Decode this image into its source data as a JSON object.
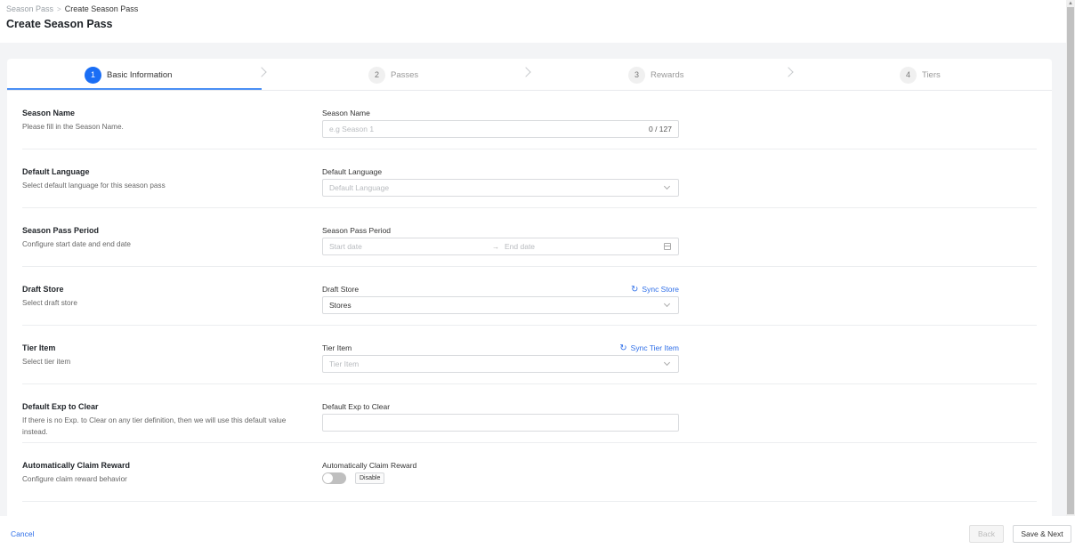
{
  "breadcrumb": {
    "parent": "Season Pass",
    "separator": ">",
    "current": "Create Season Pass"
  },
  "page_title": "Create Season Pass",
  "steps": [
    {
      "number": "1",
      "label": "Basic Information",
      "active": true
    },
    {
      "number": "2",
      "label": "Passes",
      "active": false
    },
    {
      "number": "3",
      "label": "Rewards",
      "active": false
    },
    {
      "number": "4",
      "label": "Tiers",
      "active": false
    }
  ],
  "form": {
    "season_name": {
      "title": "Season Name",
      "description": "Please fill in the Season Name.",
      "field_label": "Season Name",
      "placeholder": "e.g Season 1",
      "value": "",
      "counter": "0 / 127"
    },
    "default_language": {
      "title": "Default Language",
      "description": "Select default language for this season pass",
      "field_label": "Default Language",
      "placeholder": "Default Language"
    },
    "season_pass_period": {
      "title": "Season Pass Period",
      "description": "Configure start date and end date",
      "field_label": "Season Pass Period",
      "start_placeholder": "Start date",
      "separator": "→",
      "end_placeholder": "End date"
    },
    "draft_store": {
      "title": "Draft Store",
      "description": "Select draft store",
      "field_label": "Draft Store",
      "value": "Stores",
      "sync_label": "Sync Store"
    },
    "tier_item": {
      "title": "Tier Item",
      "description": "Select tier item",
      "field_label": "Tier Item",
      "placeholder": "Tier Item",
      "sync_label": "Sync Tier Item"
    },
    "default_exp": {
      "title": "Default Exp to Clear",
      "description": "If there is no Exp. to Clear on any tier definition, then we will use this default value instead.",
      "field_label": "Default Exp to Clear",
      "value": ""
    },
    "auto_claim": {
      "title": "Automatically Claim Reward",
      "description": "Configure claim reward behavior",
      "field_label": "Automatically Claim Reward",
      "enabled": false,
      "status_label": "Disable"
    }
  },
  "footer": {
    "cancel_label": "Cancel",
    "back_label": "Back",
    "next_label": "Save & Next"
  },
  "icons": {
    "refresh": "refresh-icon",
    "chevron": "chevron-down-icon",
    "calendar": "calendar-icon"
  },
  "colors": {
    "accent": "#1a6ef5",
    "link": "#2f6fe8"
  }
}
